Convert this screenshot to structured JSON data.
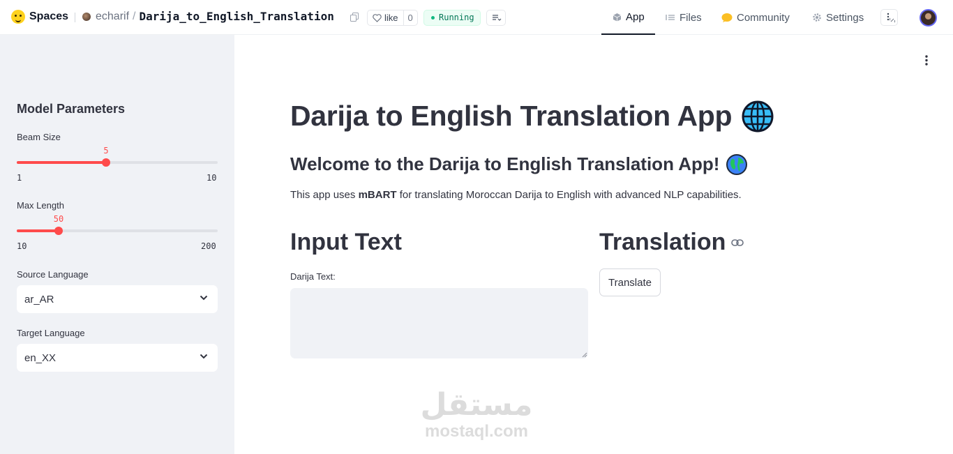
{
  "header": {
    "brand": "Spaces",
    "owner": "echarif",
    "separator": "/",
    "repo": "Darija_to_English_Translation",
    "like_label": "like",
    "like_count": "0",
    "status": "Running",
    "nav": [
      {
        "label": "App",
        "icon": "cube-icon",
        "active": true
      },
      {
        "label": "Files",
        "icon": "files-icon",
        "active": false
      },
      {
        "label": "Community",
        "icon": "community-icon",
        "active": false
      },
      {
        "label": "Settings",
        "icon": "gear-icon",
        "active": false
      }
    ]
  },
  "sidebar": {
    "title": "Model Parameters",
    "beam": {
      "label": "Beam Size",
      "value": "5",
      "min": "1",
      "max": "10"
    },
    "maxlen": {
      "label": "Max Length",
      "value": "50",
      "min": "10",
      "max": "200"
    },
    "source": {
      "label": "Source Language",
      "value": "ar_AR"
    },
    "target": {
      "label": "Target Language",
      "value": "en_XX"
    }
  },
  "main": {
    "title": "Darija to English Translation App",
    "welcome": "Welcome to the Darija to English Translation App!",
    "desc_before": "This app uses ",
    "desc_bold": "mBART",
    "desc_after": " for translating Moroccan Darija to English with advanced NLP capabilities.",
    "input_heading": "Input Text",
    "translation_heading": "Translation",
    "field_label": "Darija Text:",
    "translate_button": "Translate"
  },
  "watermark": {
    "arabic": "مستقل",
    "latin": "mostaql.com"
  },
  "colors": {
    "accent": "#ff4b4b",
    "sidebar_bg": "#f0f2f6",
    "text": "#31333f",
    "status_green": "#047857"
  }
}
